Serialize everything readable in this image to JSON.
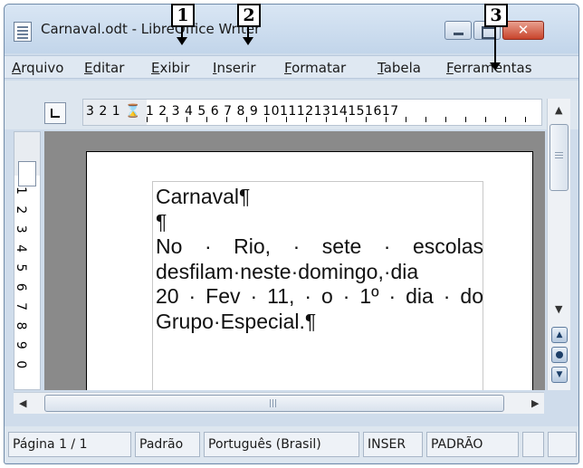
{
  "window": {
    "title": "Carnaval.odt - LibreOffice Writer",
    "close_glyph": "✕"
  },
  "markers": [
    "1",
    "2",
    "3"
  ],
  "menu": [
    {
      "label": "Arquivo"
    },
    {
      "label": "Editar"
    },
    {
      "label": "Exibir"
    },
    {
      "label": "Inserir"
    },
    {
      "label": "Formatar"
    },
    {
      "label": "Tabela"
    },
    {
      "label": "Ferramentas"
    }
  ],
  "ruler": {
    "horizontal_text": "3 2 1 ⌛ 1 2 3 4 5 6 7 8 9 1011121314151617",
    "vertical_text": "1 2 3 4 5 6 7 8 9 0"
  },
  "document": {
    "lines": [
      "Carnaval¶",
      "¶",
      "No · Rio, · sete · escolas",
      "desfilam·neste·domingo,·dia",
      "20 · Fev · 11, · o · 1º · dia · do",
      "Grupo·Especial.¶"
    ]
  },
  "scrollbars": {
    "up": "▲",
    "down": "▼",
    "left": "◀",
    "right": "▶",
    "prev": "▲",
    "next": "▼"
  },
  "status": {
    "page": "Página 1 / 1",
    "style": "Padrão",
    "language": "Português (Brasil)",
    "insert_mode": "INSER",
    "selection_mode": "PADRÃO"
  },
  "colors": {
    "title_bar": "#c2d5ea",
    "close_button": "#c8442c",
    "page_background": "#8a8a8a"
  }
}
